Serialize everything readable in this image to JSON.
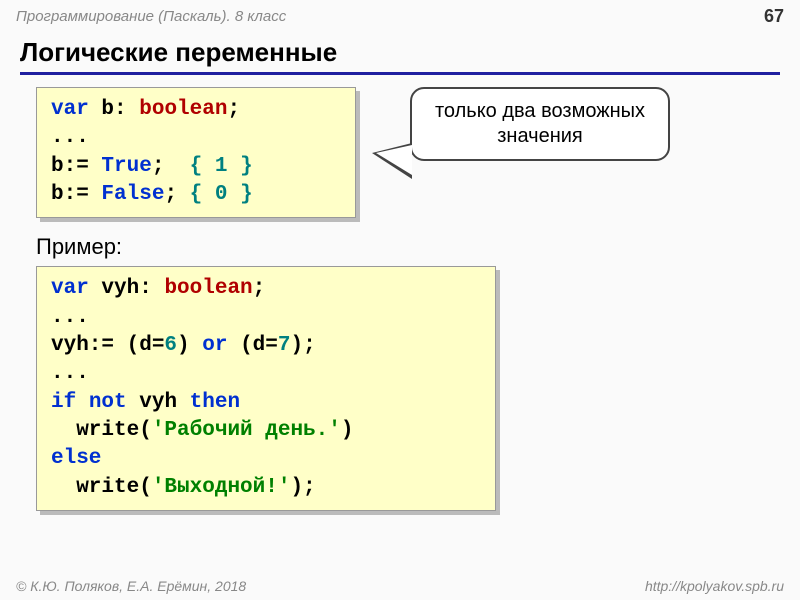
{
  "header": {
    "course": "Программирование (Паскаль). 8 класс",
    "page": "67"
  },
  "title": "Логические переменные",
  "code1": {
    "l1_var": "var",
    "l1_b": " b: ",
    "l1_bool": "boolean",
    "l1_semi": ";",
    "l2": "...",
    "l3_pre": "b:= ",
    "l3_true": "True",
    "l3_post": ";  ",
    "l3_cmt": "{ 1 }",
    "l4_pre": "b:= ",
    "l4_false": "False",
    "l4_post": "; ",
    "l4_cmt": "{ 0 }"
  },
  "callout": "только два возможных значения",
  "example_label": "Пример:",
  "code2": {
    "l1_var": "var",
    "l1_v": " vyh: ",
    "l1_bool": "boolean",
    "l1_semi": ";",
    "l2": "...",
    "l3_pre": "vyh:= (d=",
    "l3_6": "6",
    "l3_mid1": ") ",
    "l3_or": "or",
    "l3_mid2": " (d=",
    "l3_7": "7",
    "l3_post": ");",
    "l4": "...",
    "l5_if": "if",
    "l5_sp1": " ",
    "l5_not": "not",
    "l5_mid": " vyh ",
    "l5_then": "then",
    "l6_pre": "  write(",
    "l6_str": "'Рабочий день.'",
    "l6_post": ")",
    "l7_else": "else",
    "l8_pre": "  write(",
    "l8_str": "'Выходной!'",
    "l8_post": ");"
  },
  "footer": {
    "credits": "© К.Ю. Поляков, Е.А. Ерёмин, 2018",
    "url": "http://kpolyakov.spb.ru"
  }
}
